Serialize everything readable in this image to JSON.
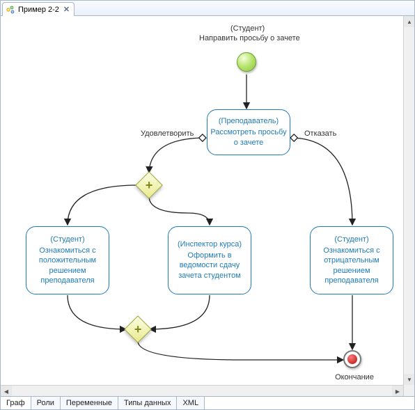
{
  "tab": {
    "title": "Пример 2-2"
  },
  "start": {
    "role": "(Студент)",
    "desc": "Направить просьбу о зачете"
  },
  "review": {
    "role": "(Преподаватель)",
    "desc": "Рассмотреть просьбу о зачете"
  },
  "edges": {
    "approve": "Удовлетворить",
    "reject": "Отказать"
  },
  "positive": {
    "role": "(Студент)",
    "desc": "Ознакомиться с положительным решением преподавателя"
  },
  "register": {
    "role": "(Инспектор курса)",
    "desc": "Оформить в ведомости сдачу зачета студентом"
  },
  "negative": {
    "role": "(Студент)",
    "desc": "Ознакомиться с отрицательным решением преподавателя"
  },
  "end_label": "Окончание",
  "bottom_tabs": [
    "Граф",
    "Роли",
    "Переменные",
    "Типы данных",
    "XML"
  ]
}
